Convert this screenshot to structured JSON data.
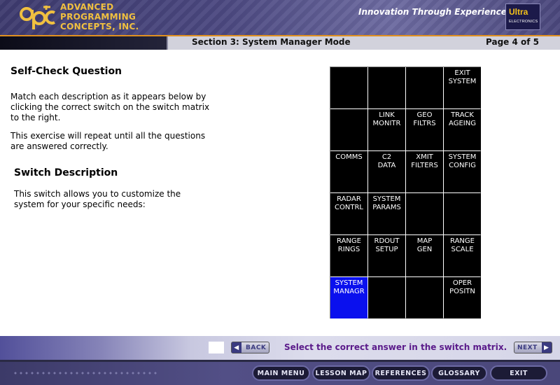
{
  "header": {
    "company_lines": [
      "ADVANCED",
      "PROGRAMMING",
      "CONCEPTS, INC."
    ],
    "tagline": "Innovation Through Experience",
    "ultra_top": "Ultra",
    "ultra_bottom": "ELECTRONICS"
  },
  "section": {
    "title": "Section 3: System Manager Mode",
    "page": "Page 4 of 5"
  },
  "content": {
    "heading": "Self-Check Question",
    "paragraph1": "Match each description as it appears below by clicking the correct switch on the switch matrix to the right.",
    "paragraph2": "This exercise will repeat until all the questions are answered correctly.",
    "switch_heading": "Switch Description",
    "switch_text": "This switch allows you to customize the system for your specific needs:"
  },
  "matrix": {
    "cells": [
      "",
      "",
      "",
      "EXIT\nSYSTEM",
      "",
      "LINK\nMONITR",
      "GEO\nFILTRS",
      "TRACK\nAGEING",
      "COMMS",
      "C2\nDATA",
      "XMIT\nFILTERS",
      "SYSTEM\nCONFIG",
      "RADAR\nCONTRL",
      "SYSTEM\nPARAMS",
      "",
      "",
      "RANGE\nRINGS",
      "RDOUT\nSETUP",
      "MAP\nGEN",
      "RANGE\nSCALE",
      "SYSTEM\nMANAGR",
      "",
      "",
      "OPER\nPOSITN"
    ],
    "selected_index": 20,
    "selected_color": "#0a10ee"
  },
  "navigation": {
    "back_label": "BACK",
    "next_label": "NEXT",
    "instruction": "Select the correct answer in the switch matrix."
  },
  "footer": {
    "buttons": [
      "MAIN MENU",
      "LESSON MAP",
      "REFERENCES",
      "GLOSSARY",
      "EXIT"
    ]
  },
  "colors": {
    "brand_gold": "#f0c040",
    "instruction_purple": "#5a1a8a"
  }
}
